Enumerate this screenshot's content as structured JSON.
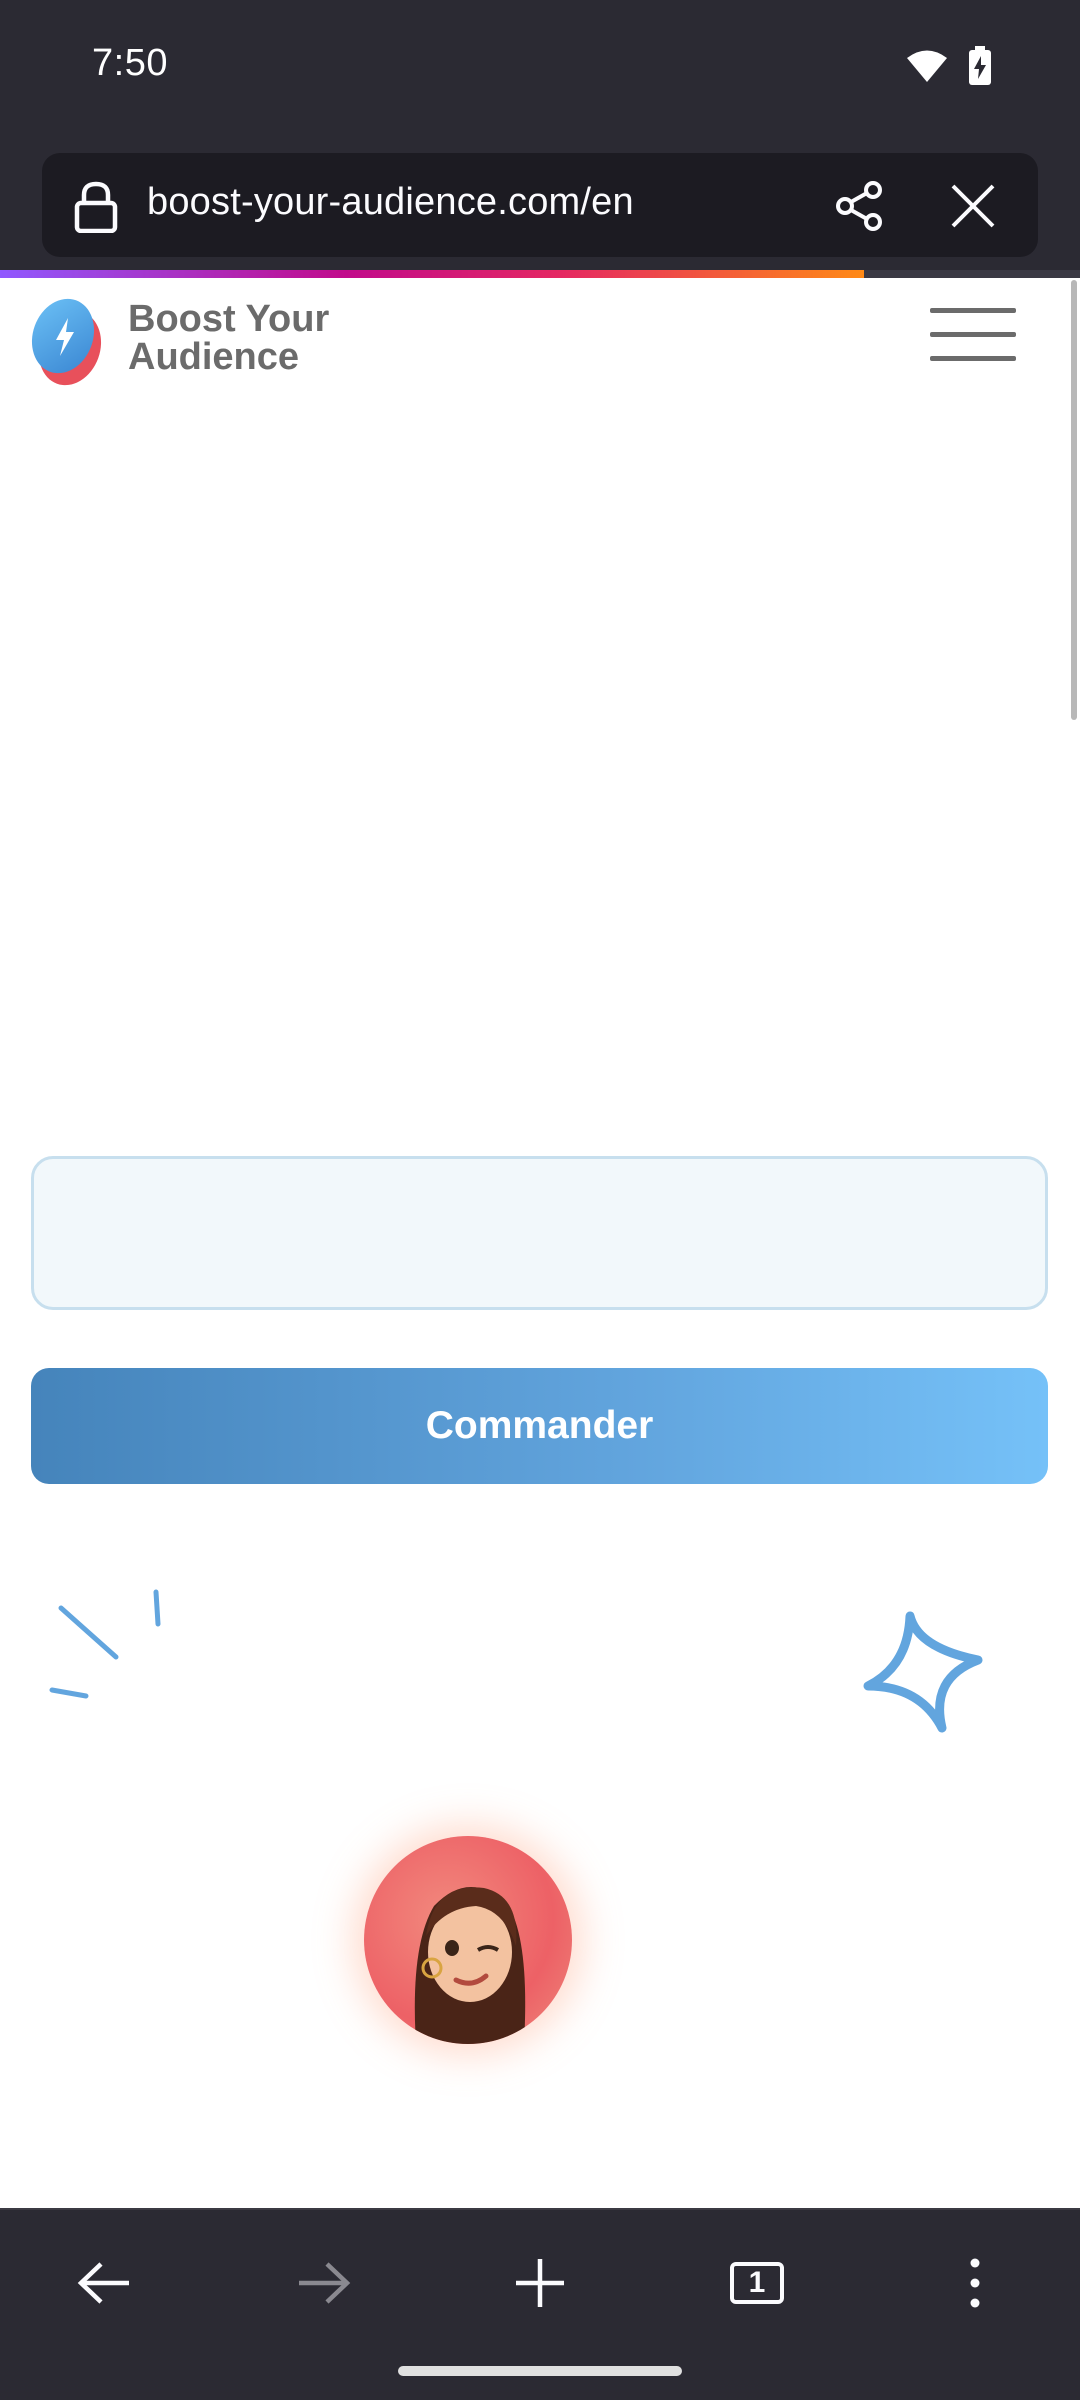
{
  "status_bar": {
    "time": "7:50",
    "wifi_icon": "wifi-icon",
    "battery_icon": "battery-charging-icon"
  },
  "toolbar": {
    "url": "boost-your-audience.com/en",
    "lock_icon": "lock-icon",
    "share_icon": "share-icon",
    "close_icon": "close-icon"
  },
  "progress": {
    "value": 0.8,
    "gradient": [
      "#9059ff",
      "#c10b8b",
      "#e52862",
      "#ff8a16"
    ]
  },
  "page": {
    "brand_line1": "Boost Your",
    "brand_line2": "Audience",
    "menu_icon": "hamburger-menu-icon",
    "input_value": "",
    "order_button": "Commander",
    "accent_color": "#62a5de"
  },
  "bottom_nav": {
    "back_icon": "back-arrow-icon",
    "forward_icon": "forward-arrow-icon",
    "new_tab_icon": "plus-icon",
    "tabs_count": "1",
    "more_icon": "more-vert-icon"
  }
}
